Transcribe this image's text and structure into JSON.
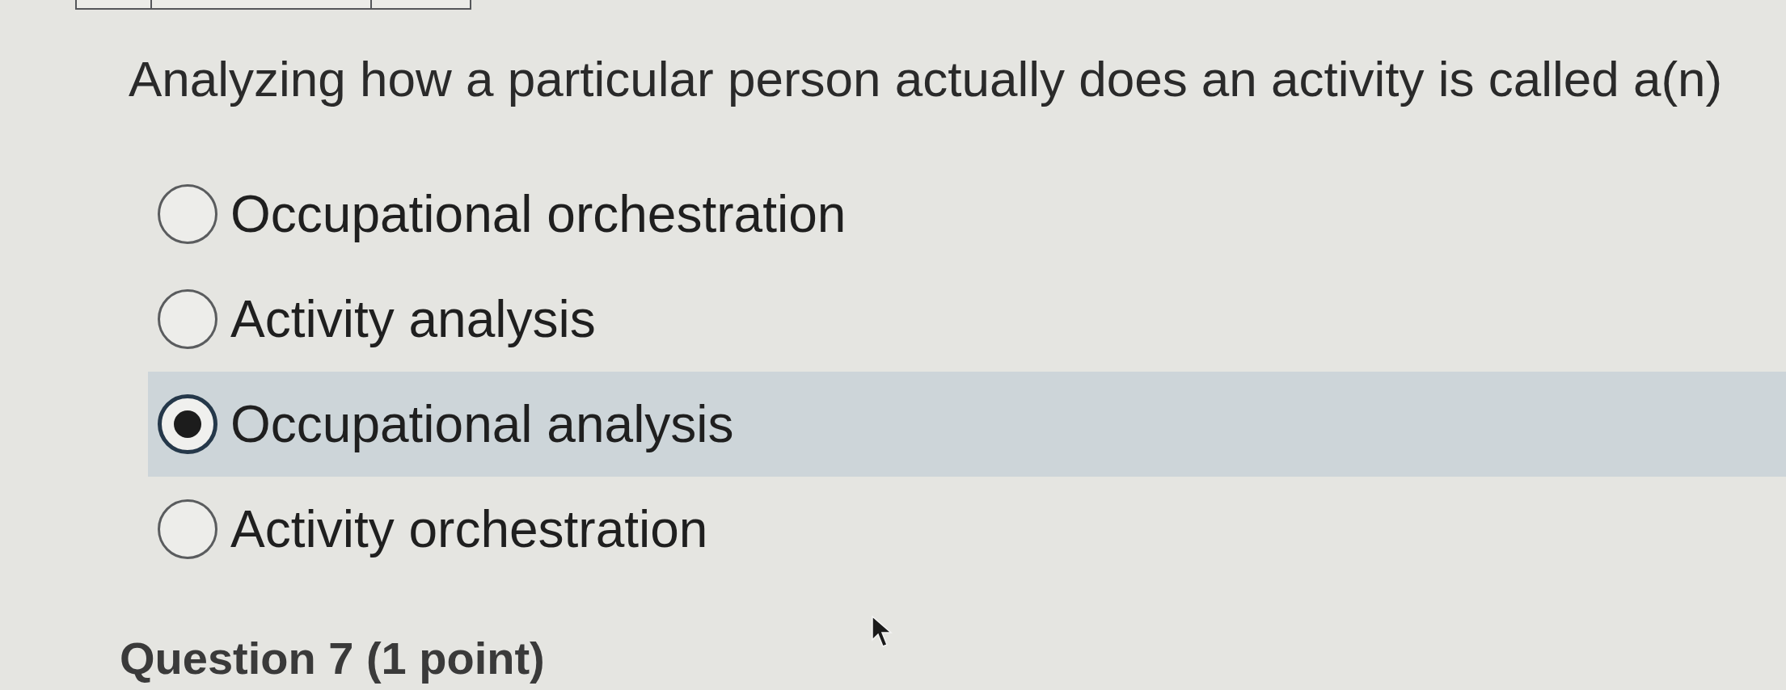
{
  "question": {
    "text": "Analyzing how a particular person actually does an activity is called a(n)"
  },
  "options": [
    {
      "label": "Occupational orchestration",
      "selected": false
    },
    {
      "label": "Activity analysis",
      "selected": false
    },
    {
      "label": "Occupational analysis",
      "selected": true
    },
    {
      "label": "Activity orchestration",
      "selected": false
    }
  ],
  "next_question": {
    "heading": "Question 7 (1 point)"
  }
}
